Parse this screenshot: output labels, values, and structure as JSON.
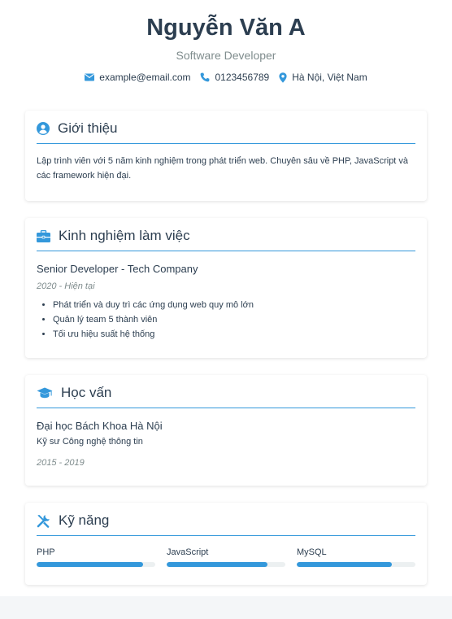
{
  "profile": {
    "name": "Nguyễn Văn A",
    "title": "Software Developer",
    "contact": {
      "email": "example@email.com",
      "phone": "0123456789",
      "location": "Hà Nội, Việt Nam"
    }
  },
  "colors": {
    "accent": "#3498db",
    "text": "#2c3e50",
    "muted": "#7f8c8d"
  },
  "sections": {
    "about": {
      "title": "Giới thiệu",
      "icon": "user-icon",
      "text": "Lập trình viên với 5 năm kinh nghiệm trong phát triển web. Chuyên sâu về PHP, JavaScript và các framework hiện đại."
    },
    "experience": {
      "title": "Kinh nghiệm làm việc",
      "icon": "briefcase-icon",
      "job_title": "Senior Developer - Tech Company",
      "period": "2020 - Hiện tại",
      "bullets": [
        "Phát triển và duy trì các ứng dụng web quy mô lớn",
        "Quản lý team 5 thành viên",
        "Tối ưu hiệu suất hệ thống"
      ]
    },
    "education": {
      "title": "Học vấn",
      "icon": "graduation-cap-icon",
      "school": "Đại học Bách Khoa Hà Nội",
      "degree": "Kỹ sư Công nghệ thông tin",
      "period": "2015 - 2019"
    },
    "skills": {
      "title": "Kỹ năng",
      "icon": "tools-icon",
      "items": [
        {
          "name": "PHP",
          "level": 0.9
        },
        {
          "name": "JavaScript",
          "level": 0.85
        },
        {
          "name": "MySQL",
          "level": 0.8
        }
      ]
    }
  }
}
